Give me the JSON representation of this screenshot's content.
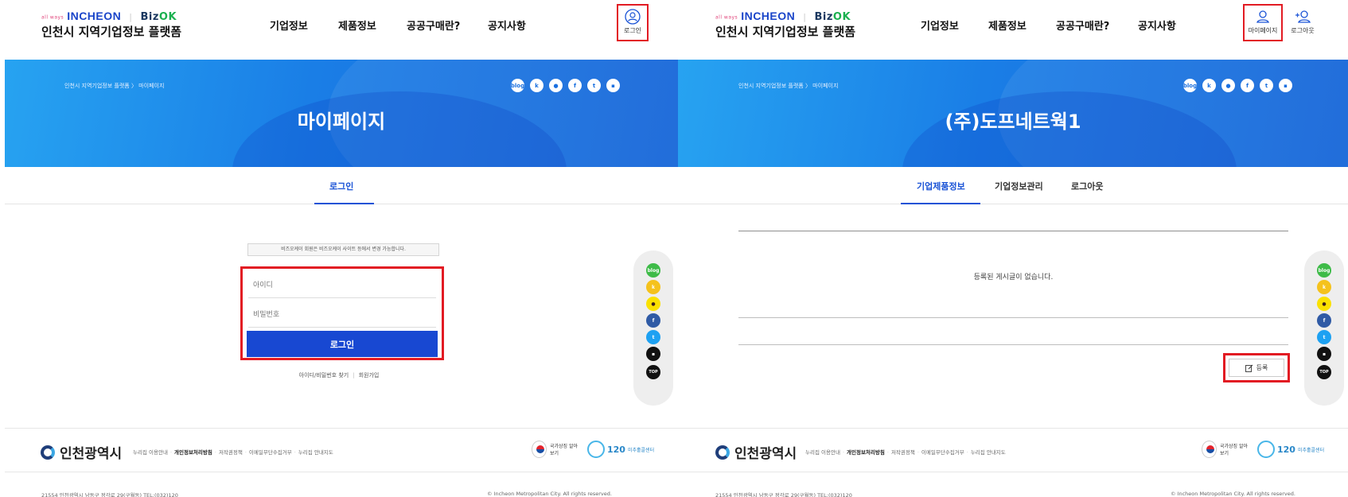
{
  "header": {
    "logo_tag": "all ways",
    "logo_brand": "INCHEON",
    "logo_biz": "Biz",
    "logo_ok": "OK",
    "logo_title": "인천시 지역기업정보 플랫폼",
    "nav": [
      "기업정보",
      "제품정보",
      "공공구매란?",
      "공지사항"
    ]
  },
  "left": {
    "util_login_label": "로그인",
    "breadcrumb": "인천시 지역기업정보 플랫폼 〉 마이페이지",
    "banner_title": "마이페이지",
    "tabs": [
      "로그인"
    ],
    "notice": "비즈오케이 회원은 비즈오케이 사이트 등에서 변경 가능합니다.",
    "id_placeholder": "아이디",
    "pw_placeholder": "비밀번호",
    "login_button": "로그인",
    "find_link": "아이디/비밀번호 찾기",
    "join_link": "회원가입"
  },
  "right": {
    "util_mypage_label": "마이페이지",
    "util_logout_label": "로그아웃",
    "breadcrumb": "인천시 지역기업정보 플랫폼 〉 마이페이지",
    "banner_title": "(주)도프네트웍1",
    "tabs": [
      "기업제품정보",
      "기업정보관리",
      "로그아웃"
    ],
    "empty_message": "등록된 게시글이 없습니다.",
    "register_button": "등록"
  },
  "social": [
    "blog",
    "k",
    "talk",
    "f",
    "t",
    "b"
  ],
  "quick_menu": [
    "blog",
    "k",
    "talk",
    "f",
    "t",
    "b",
    "TOP"
  ],
  "footer": {
    "city_logo": "인천광역시",
    "links": [
      "누리집 이용안내",
      "개인정보처리방침",
      "저작권정책",
      "이메일무단수집거부",
      "누리집 안내지도"
    ],
    "badge_national": "국가상징 알아보기",
    "badge_call_number": "120",
    "badge_call_text": "미추홀콜센터",
    "address": "21554 인천광역시 남동구 정각로 29(구월동) TEL:(032)120",
    "copyright": "© Incheon Metropolitan City. All rights reserved."
  },
  "colors": {
    "accent": "#1a53d6",
    "highlight_red": "#e21b23",
    "banner_blue": "#1a7ee6"
  }
}
